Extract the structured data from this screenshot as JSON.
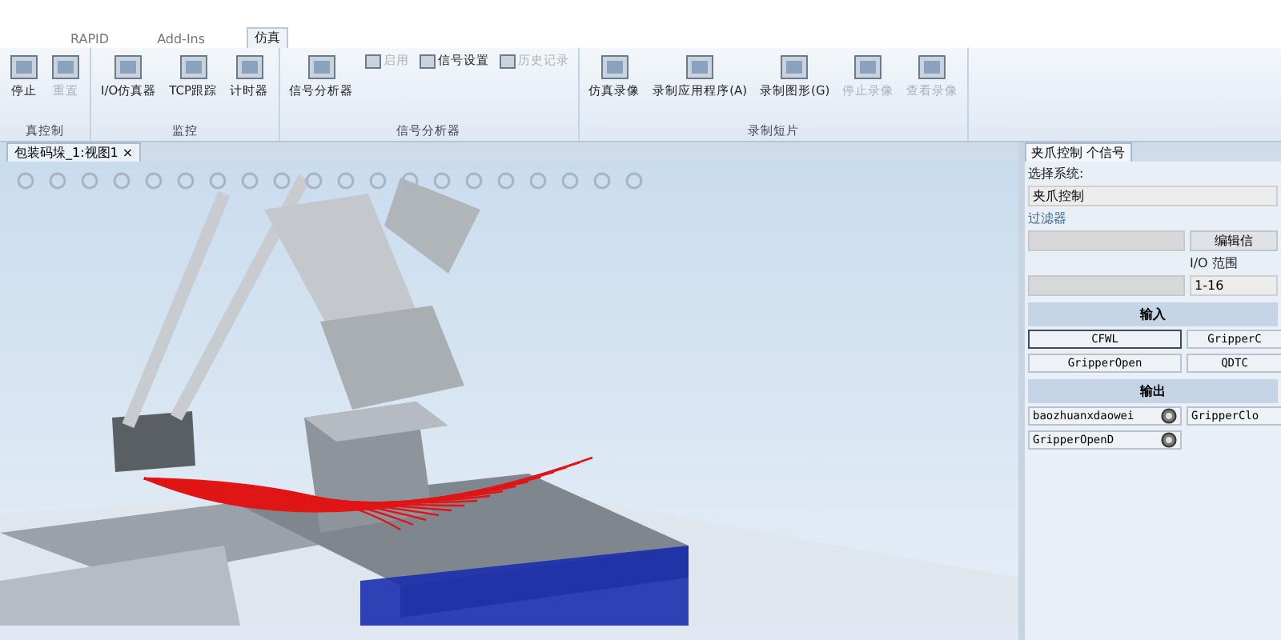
{
  "menu_tabs": [
    {
      "label": "RAPID",
      "selected": false
    },
    {
      "label": "Add-Ins",
      "selected": false
    },
    {
      "label": "仿真",
      "selected": true
    }
  ],
  "ribbon": {
    "groups": [
      {
        "label": "真控制",
        "buttons": [
          {
            "label": "停止",
            "kind": "large",
            "disabled": false
          },
          {
            "label": "重置",
            "kind": "large",
            "disabled": true
          }
        ]
      },
      {
        "label": "监控",
        "buttons": [
          {
            "label": "I/O仿真器",
            "kind": "large",
            "disabled": false
          },
          {
            "label": "TCP跟踪",
            "kind": "large",
            "disabled": false
          },
          {
            "label": "计时器",
            "kind": "large",
            "disabled": false
          }
        ]
      },
      {
        "label": "信号分析器",
        "buttons": [
          {
            "label": "信号分析器",
            "kind": "large",
            "disabled": false
          },
          {
            "label": "启用",
            "kind": "small",
            "disabled": true
          },
          {
            "label": "信号设置",
            "kind": "small",
            "disabled": false
          },
          {
            "label": "历史记录",
            "kind": "small",
            "disabled": true
          }
        ]
      },
      {
        "label": "录制短片",
        "buttons": [
          {
            "label": "仿真录像",
            "kind": "large",
            "disabled": false
          },
          {
            "label": "录制应用程序(A)",
            "kind": "large",
            "disabled": false
          },
          {
            "label": "录制图形(G)",
            "kind": "large",
            "disabled": false
          },
          {
            "label": "停止录像",
            "kind": "large",
            "disabled": true
          },
          {
            "label": "查看录像",
            "kind": "large",
            "disabled": true
          }
        ]
      }
    ]
  },
  "document_tab": {
    "label": "包装码垛_1:视图1",
    "close": "×"
  },
  "io_panel": {
    "tab": "夹爪控制 个信号",
    "system_label": "选择系统:",
    "system_value": "夹爪控制",
    "filter_label": "过滤器",
    "edit_button": "编辑信",
    "range_label": "I/O 范围",
    "range_value": "1-16",
    "inputs_title": "输入",
    "inputs": [
      {
        "name": "CFWL",
        "selected": true
      },
      {
        "name": "GripperC",
        "selected": false
      },
      {
        "name": "GripperOpen",
        "selected": false
      },
      {
        "name": "QDTC",
        "selected": false
      }
    ],
    "outputs_title": "输出",
    "outputs": [
      {
        "name": "baozhuanxdaowei",
        "toggle": true
      },
      {
        "name": "GripperClo",
        "toggle": false
      },
      {
        "name": "GripperOpenD",
        "toggle": true
      }
    ]
  }
}
